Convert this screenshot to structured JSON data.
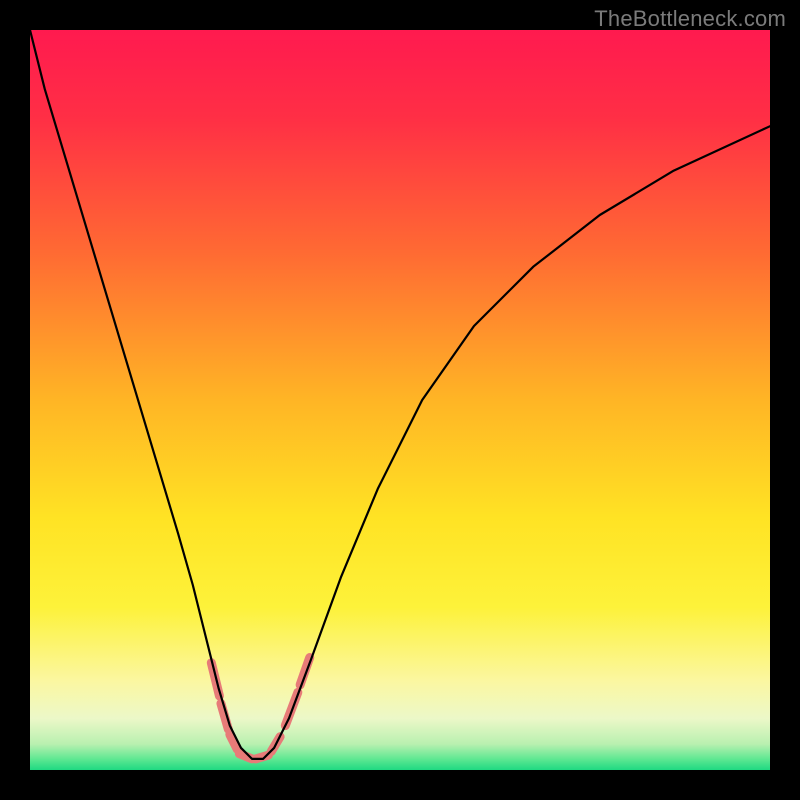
{
  "watermark": "TheBottleneck.com",
  "chart_data": {
    "type": "line",
    "title": "",
    "xlabel": "",
    "ylabel": "",
    "xlim": [
      0,
      100
    ],
    "ylim": [
      0,
      100
    ],
    "grid": false,
    "legend": false,
    "gradient_stops": [
      {
        "pos": 0.0,
        "color": "#ff1a4f"
      },
      {
        "pos": 0.12,
        "color": "#ff2f45"
      },
      {
        "pos": 0.3,
        "color": "#ff6a33"
      },
      {
        "pos": 0.5,
        "color": "#ffb525"
      },
      {
        "pos": 0.66,
        "color": "#ffe324"
      },
      {
        "pos": 0.78,
        "color": "#fdf23a"
      },
      {
        "pos": 0.88,
        "color": "#fbf7a1"
      },
      {
        "pos": 0.93,
        "color": "#ecf8c8"
      },
      {
        "pos": 0.965,
        "color": "#b9f0b0"
      },
      {
        "pos": 0.985,
        "color": "#5fe892"
      },
      {
        "pos": 1.0,
        "color": "#1fd982"
      }
    ],
    "series": [
      {
        "name": "bottleneck-curve",
        "x": [
          0,
          2,
          5,
          8,
          11,
          14,
          17,
          20,
          22,
          24,
          25.5,
          27,
          28.5,
          30,
          31.5,
          33,
          35,
          38,
          42,
          47,
          53,
          60,
          68,
          77,
          87,
          100
        ],
        "y": [
          100,
          92,
          82,
          72,
          62,
          52,
          42,
          32,
          25,
          17,
          11,
          6,
          3,
          1.5,
          1.5,
          3,
          7,
          15,
          26,
          38,
          50,
          60,
          68,
          75,
          81,
          87
        ],
        "stroke": "#000000",
        "stroke_width": 2.2
      }
    ],
    "threshold_segments": [
      {
        "x1": 24.5,
        "y1": 14.5,
        "x2": 25.6,
        "y2": 10.0
      },
      {
        "x1": 25.8,
        "y1": 9.0,
        "x2": 26.8,
        "y2": 5.5
      },
      {
        "x1": 27.0,
        "y1": 4.8,
        "x2": 28.0,
        "y2": 2.8
      },
      {
        "x1": 28.3,
        "y1": 2.2,
        "x2": 30.0,
        "y2": 1.5
      },
      {
        "x1": 30.5,
        "y1": 1.5,
        "x2": 32.2,
        "y2": 2.0
      },
      {
        "x1": 32.6,
        "y1": 2.5,
        "x2": 33.8,
        "y2": 4.5
      },
      {
        "x1": 34.5,
        "y1": 6.0,
        "x2": 36.2,
        "y2": 10.5
      },
      {
        "x1": 36.5,
        "y1": 11.5,
        "x2": 37.8,
        "y2": 15.2
      }
    ],
    "threshold_style": {
      "stroke": "#e77b78",
      "stroke_width": 9,
      "linecap": "round"
    }
  }
}
